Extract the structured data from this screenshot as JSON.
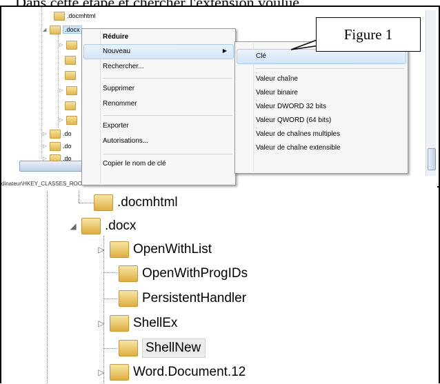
{
  "heading": "Dans cette étape et chercher l'extension voulue,",
  "top_tree": {
    "items": [
      ".docmhtml",
      ".docx",
      ".do",
      ".do",
      ".do"
    ],
    "status_path": "dinateur\\HKEY_CLASSES_ROOT\\.docx"
  },
  "context_menu": {
    "items": [
      "Réduire",
      "Nouveau",
      "Rechercher...",
      "Supprimer",
      "Renommer",
      "Exporter",
      "Autorisations...",
      "Copier le nom de clé"
    ]
  },
  "submenu": {
    "items": [
      "Clé",
      "Valeur chaîne",
      "Valeur binaire",
      "Valeur DWORD 32 bits",
      "Valeur QWORD (64 bits)",
      "Valeur de chaînes multiples",
      "Valeur de chaîne extensible"
    ]
  },
  "callout": "Figure 1",
  "bottom_tree": {
    "items": [
      ".docmhtml",
      ".docx",
      "OpenWithList",
      "OpenWithProgIDs",
      "PersistentHandler",
      "ShellEx",
      "ShellNew",
      "Word.Document.12"
    ]
  },
  "colors": {
    "highlight": "#d3e6fa",
    "folder": "#e2b750",
    "selection": "#ececec"
  }
}
